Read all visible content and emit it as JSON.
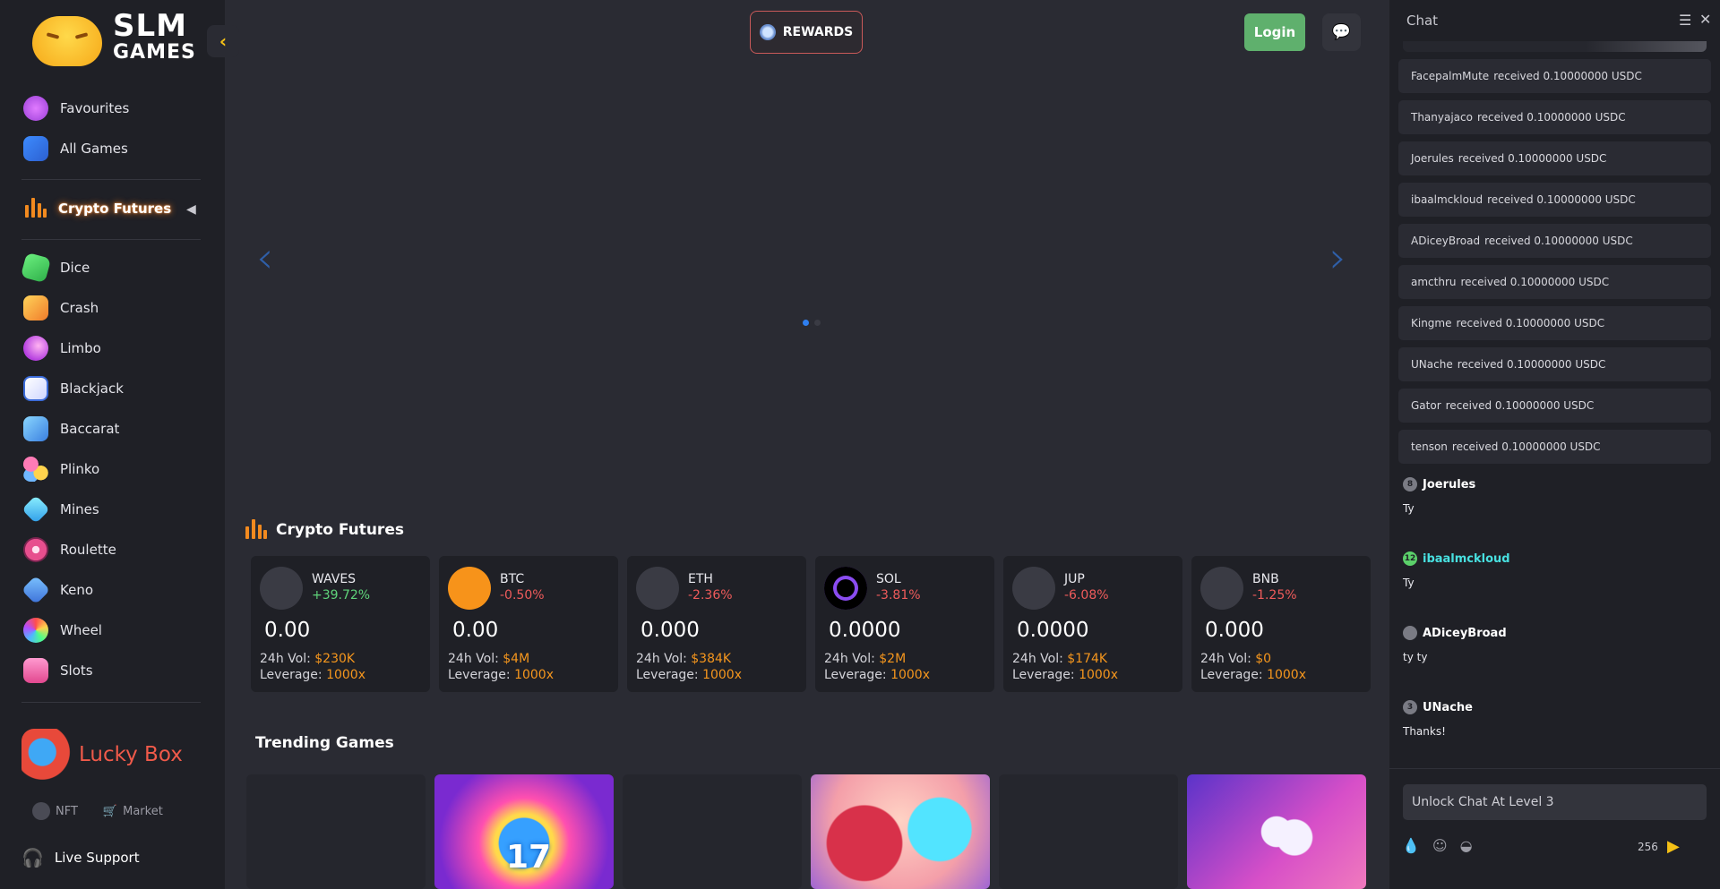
{
  "sidebar": {
    "logo": {
      "line1": "SLM",
      "line2": "GAMES"
    },
    "top_items": [
      {
        "label": "Favourites",
        "icon": "smiley-icon"
      },
      {
        "label": "All Games",
        "icon": "grid-icon"
      }
    ],
    "crypto_futures": "Crypto Futures",
    "games": [
      {
        "label": "Dice",
        "icon": "dice-icon"
      },
      {
        "label": "Crash",
        "icon": "rocket-icon"
      },
      {
        "label": "Limbo",
        "icon": "limbo-icon"
      },
      {
        "label": "Blackjack",
        "icon": "cards-icon"
      },
      {
        "label": "Baccarat",
        "icon": "baccarat-icon"
      },
      {
        "label": "Plinko",
        "icon": "plinko-icon"
      },
      {
        "label": "Mines",
        "icon": "diamond-icon"
      },
      {
        "label": "Roulette",
        "icon": "roulette-icon"
      },
      {
        "label": "Keno",
        "icon": "keno-icon"
      },
      {
        "label": "Wheel",
        "icon": "wheel-icon"
      },
      {
        "label": "Slots",
        "icon": "slots-icon"
      }
    ],
    "lucky_box": "Lucky Box",
    "nft": "NFT",
    "market": "Market",
    "live_support": "Live Support"
  },
  "header": {
    "rewards": "REWARDS",
    "login": "Login"
  },
  "crypto_section": {
    "title": "Crypto Futures",
    "vol_label": "24h Vol:",
    "lev_label": "Leverage:",
    "cards": [
      {
        "symbol": "WAVES",
        "change": "+39.72%",
        "price": "0.00",
        "volume": "$230K",
        "leverage": "1000x"
      },
      {
        "symbol": "BTC",
        "change": "-0.50%",
        "price": "0.00",
        "volume": "$4M",
        "leverage": "1000x"
      },
      {
        "symbol": "ETH",
        "change": "-2.36%",
        "price": "0.000",
        "volume": "$384K",
        "leverage": "1000x"
      },
      {
        "symbol": "SOL",
        "change": "-3.81%",
        "price": "0.0000",
        "volume": "$2M",
        "leverage": "1000x"
      },
      {
        "symbol": "JUP",
        "change": "-6.08%",
        "price": "0.0000",
        "volume": "$174K",
        "leverage": "1000x"
      },
      {
        "symbol": "BNB",
        "change": "-1.25%",
        "price": "0.000",
        "volume": "$0",
        "leverage": "1000x"
      }
    ]
  },
  "trending": {
    "title": "Trending Games",
    "tile_17_number": "17"
  },
  "chat": {
    "title": "Chat",
    "system_messages": [
      {
        "user": "FacepalmMute",
        "text": "received 0.10000000 USDC"
      },
      {
        "user": "Thanyajaco",
        "text": "received 0.10000000 USDC"
      },
      {
        "user": "Joerules",
        "text": "received 0.10000000 USDC"
      },
      {
        "user": "ibaalmckloud",
        "text": "received 0.10000000 USDC"
      },
      {
        "user": "ADiceyBroad",
        "text": "received 0.10000000 USDC"
      },
      {
        "user": "amcthru",
        "text": "received 0.10000000 USDC"
      },
      {
        "user": "Kingme",
        "text": "received 0.10000000 USDC"
      },
      {
        "user": "UNache",
        "text": "received 0.10000000 USDC"
      },
      {
        "user": "Gator",
        "text": "received 0.10000000 USDC"
      },
      {
        "user": "tenson",
        "text": "received 0.10000000 USDC"
      }
    ],
    "user_messages": [
      {
        "user": "Joerules",
        "level": "8",
        "text": "Ty"
      },
      {
        "user": "ibaalmckloud",
        "level": "12",
        "text": "Ty"
      },
      {
        "user": "ADiceyBroad",
        "level": "",
        "text": "ty ty"
      },
      {
        "user": "UNache",
        "level": "3",
        "text": "Thanks!"
      }
    ],
    "input_placeholder": "Unlock Chat At Level 3",
    "char_count": "256"
  },
  "colors": {
    "accent": "#f5c116",
    "login": "#5fb06d",
    "positive": "#5fd37a",
    "negative": "#ef5b5b",
    "volume": "#f5961d"
  }
}
